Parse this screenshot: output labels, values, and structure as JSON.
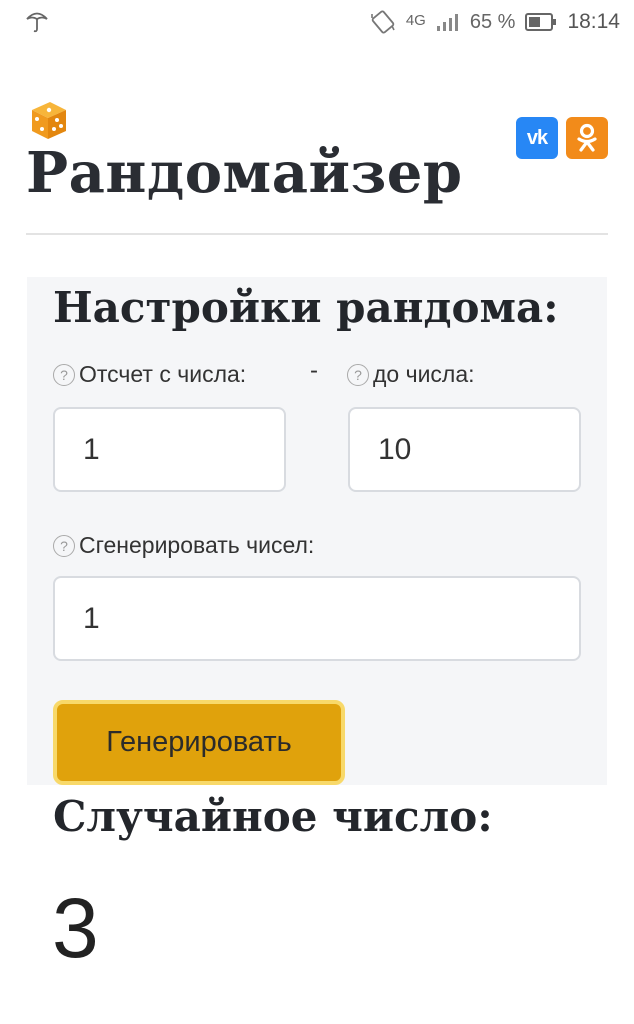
{
  "status_bar": {
    "network": "4G",
    "battery_percent": "65 %",
    "time": "18:14",
    "icons": [
      "umbrella-icon",
      "rotate-icon",
      "signal-icon",
      "battery-icon"
    ]
  },
  "header": {
    "logo_icon": "dice-icon",
    "title": "Рандомайзер",
    "social": [
      {
        "name": "vk",
        "label": "vk",
        "color": "#2787f5"
      },
      {
        "name": "ok",
        "label": "ok",
        "color": "#f28b1a"
      }
    ]
  },
  "settings": {
    "title": "Настройки рандома:",
    "from_label": "Отсчет с числа:",
    "separator": "-",
    "to_label": "до числа:",
    "from_value": "1",
    "to_value": "10",
    "count_label": "Сгенерировать чисел:",
    "count_value": "1",
    "help_glyph": "?",
    "generate_button": "Генерировать",
    "accent_color": "#e0a20c"
  },
  "result": {
    "title": "Случайное число:",
    "value": "3"
  }
}
